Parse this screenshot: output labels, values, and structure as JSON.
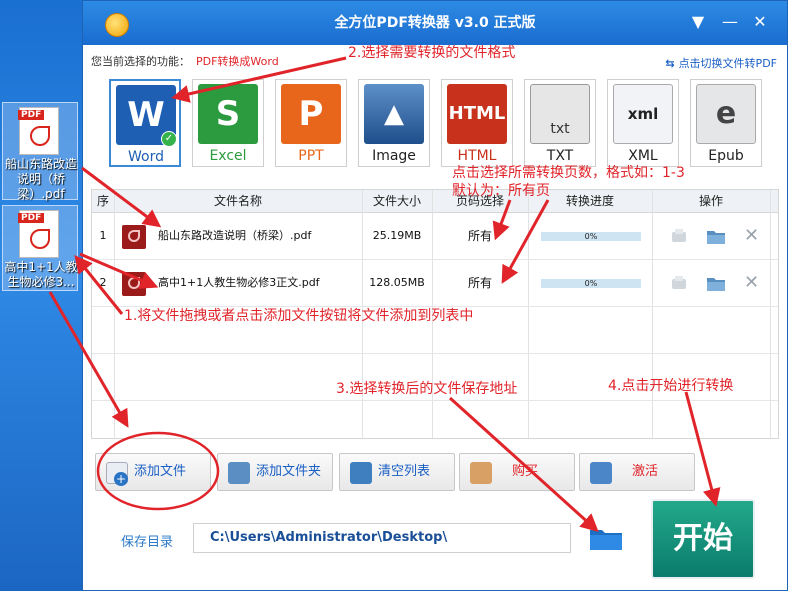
{
  "desktop": {
    "icons": [
      {
        "label": "船山东路改造说明（桥梁）.pdf",
        "tag": "PDF"
      },
      {
        "label": "高中1+1人教生物必修3...",
        "tag": "PDF"
      }
    ]
  },
  "window": {
    "title": "全方位PDF转换器 v3.0 正式版",
    "controls": {
      "menu": "▼",
      "minimize": "—",
      "close": "✕"
    }
  },
  "function_row": {
    "label": "您当前选择的功能：",
    "value": "PDF转换成Word",
    "switch_label": "点击切换文件转PDF"
  },
  "formats": [
    {
      "name": "Word",
      "glyph": "W",
      "color": "#1e5fb4",
      "selected": true
    },
    {
      "name": "Excel",
      "glyph": "S",
      "color": "#2c9a3e",
      "selected": false
    },
    {
      "name": "PPT",
      "glyph": "P",
      "color": "#e8661c",
      "selected": false
    },
    {
      "name": "Image",
      "glyph": "▲",
      "color": "#2c5e9a",
      "selected": false
    },
    {
      "name": "HTML",
      "glyph": "HTML",
      "color": "#c8321c",
      "selected": false
    },
    {
      "name": "TXT",
      "glyph": "txt",
      "color": "#e6e6e6",
      "selected": false
    },
    {
      "name": "XML",
      "glyph": "xml",
      "color": "#f1f3f6",
      "selected": false
    },
    {
      "name": "Epub",
      "glyph": "e",
      "color": "#e4e6e8",
      "selected": false
    }
  ],
  "table": {
    "headers": [
      "序",
      "文件名称",
      "文件大小",
      "页码选择",
      "转换进度",
      "操作"
    ],
    "rows": [
      {
        "index": "1",
        "name": "船山东路改造说明（桥梁）.pdf",
        "size": "25.19MB",
        "pages": "所有",
        "progress": 0,
        "progress_text": "0%"
      },
      {
        "index": "2",
        "name": "高中1+1人教生物必修3正文.pdf",
        "size": "128.05MB",
        "pages": "所有",
        "progress": 0,
        "progress_text": "0%"
      }
    ]
  },
  "toolbar": {
    "add_file": "添加文件",
    "add_folder": "添加文件夹",
    "clear_list": "清空列表",
    "buy": "购买",
    "activate": "激活"
  },
  "save": {
    "label": "保存目录",
    "path": "C:\\Users\\Administrator\\Desktop\\"
  },
  "start_button": "开始",
  "annotations": {
    "step2": "2.选择需要转换的文件格式",
    "page_hint_1": "点击选择所需转换页数，格式如：1-3",
    "page_hint_2": "默认为：所有页",
    "step1": "1.将文件拖拽或者点击添加文件按钮将文件添加到列表中",
    "step3": "3.选择转换后的文件保存地址",
    "step4": "4.点击开始进行转换"
  },
  "colors": {
    "accent": "#1a6ccf",
    "annotation": "#e0242a",
    "start": "#0f8c74"
  }
}
